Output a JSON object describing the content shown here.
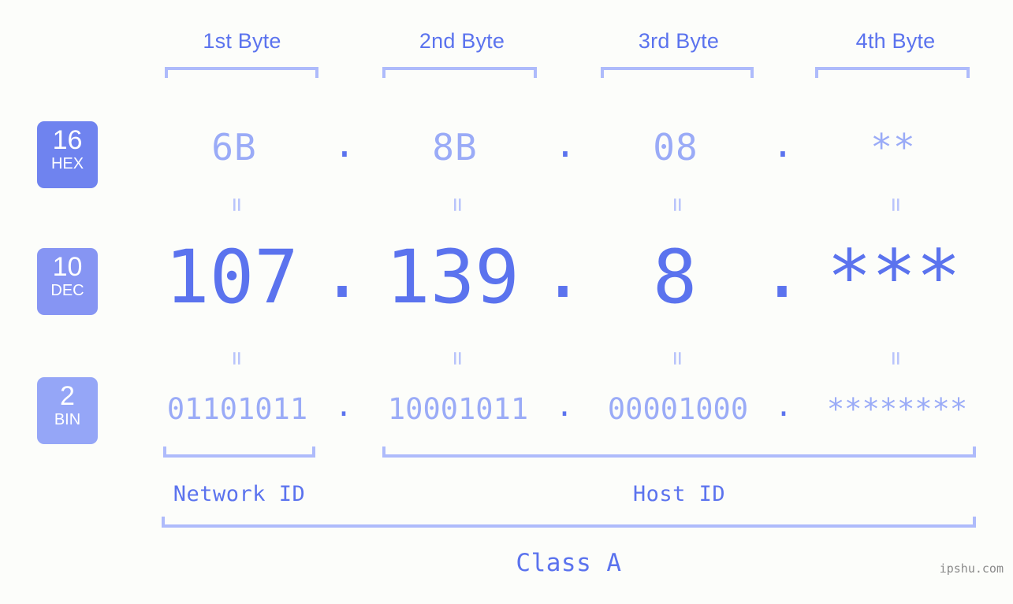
{
  "page": {
    "background_color": "#fcfdfa",
    "accent_color": "#5b73ee",
    "accent_light_color": "#9aabf7",
    "bracket_color": "#aebbfb",
    "watermark": "ipshu.com"
  },
  "byte_headers": [
    {
      "label": "1st Byte"
    },
    {
      "label": "2nd Byte"
    },
    {
      "label": "3rd Byte"
    },
    {
      "label": "4th Byte"
    }
  ],
  "bases": [
    {
      "number": "16",
      "name": "HEX",
      "color": "#6f83ef"
    },
    {
      "number": "10",
      "name": "DEC",
      "color": "#8695f3"
    },
    {
      "number": "2",
      "name": "BIN",
      "color": "#95a6f7"
    }
  ],
  "rows": {
    "hex": {
      "values": [
        "6B",
        "8B",
        "08",
        "**"
      ],
      "separators": [
        ".",
        ".",
        "."
      ]
    },
    "dec": {
      "values": [
        "107",
        "139",
        "8",
        "***"
      ],
      "separators": [
        ".",
        ".",
        "."
      ]
    },
    "bin": {
      "values": [
        "01101011",
        "10001011",
        "00001000",
        "********"
      ],
      "separators": [
        ".",
        ".",
        "."
      ]
    }
  },
  "equality_marks": {
    "symbol": "=",
    "row1_count": 4,
    "row2_count": 4
  },
  "regions": {
    "network_id": "Network ID",
    "host_id": "Host ID",
    "class": "Class A"
  }
}
